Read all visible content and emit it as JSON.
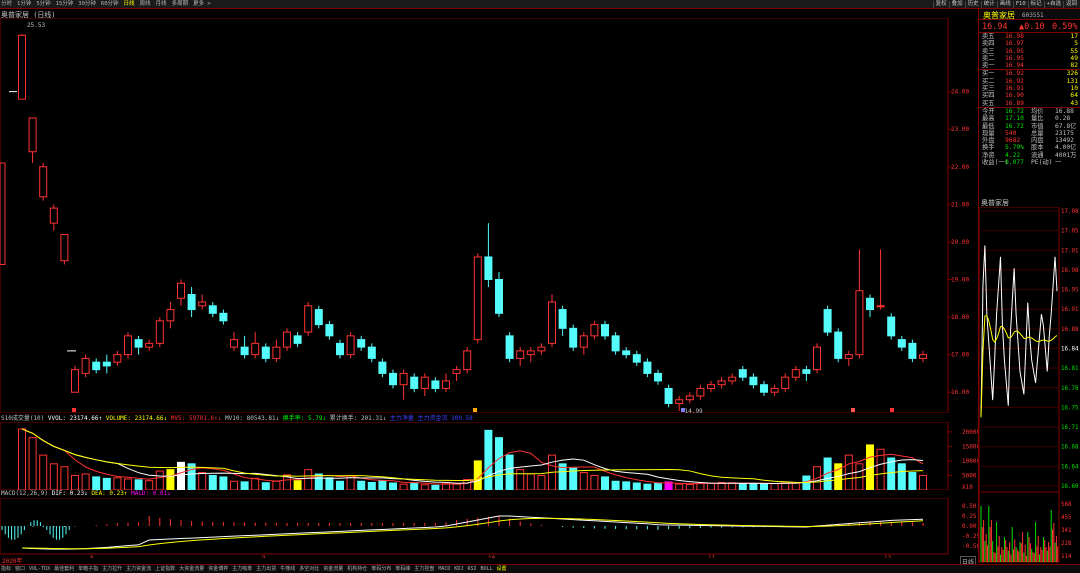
{
  "toolbar": {
    "tabs": [
      "分时",
      "1分钟",
      "5分钟",
      "15分钟",
      "30分钟",
      "60分钟",
      "日线",
      "周线",
      "月线",
      "多周期",
      "更多 >"
    ],
    "active_tab": "日线",
    "right_buttons": [
      "复权",
      "叠加",
      "历史",
      "统计",
      "画线",
      "F10",
      "标记",
      "+自选",
      "返回"
    ]
  },
  "chart": {
    "title": "奥普家居 (日线)",
    "year_label": "2020年",
    "period_label": "日线",
    "high_label": "25.53",
    "low_label": "14.99",
    "price_ticks": [
      "24.00",
      "23.00",
      "22.00",
      "21.00",
      "20.00",
      "19.00",
      "18.00",
      "17.00",
      "16.00"
    ],
    "x_ticks": [
      "8",
      "9",
      "10",
      "11",
      "12"
    ],
    "indicator_vol": {
      "name": "S10成交量(10)",
      "vvol": "VVOL: 23174.66↑",
      "volume": "VOLUME: 23174.66↓",
      "mv5": "MV5: 59701.6↑↓",
      "mv10": "MV10: 80543.81↓",
      "turnover": "换手率: 5.79↓",
      "acc_turnover": "累计换手: 201.31↓",
      "extra1": "主力净量",
      "extra2": "主力资金流 100.58",
      "ticks": [
        "20000",
        "15000",
        "10000",
        "5000",
        "X10"
      ]
    },
    "indicator_macd": {
      "name": "MACD(12,26,9)",
      "dif": "DIF: 0.23↓",
      "dea": "DEA: 0.23↑",
      "macd": "MACD: 0.01↓",
      "ticks": [
        "0.50",
        "0.25",
        "0.00",
        "-0.25",
        "-0.50"
      ]
    }
  },
  "quote": {
    "name": "奥普家居",
    "code": "603551",
    "price": "16.94",
    "change": "▲0.10",
    "change_pct": "0.59%",
    "asks": [
      {
        "label": "卖五",
        "price": "16.98",
        "vol": "17"
      },
      {
        "label": "卖四",
        "price": "16.97",
        "vol": "5"
      },
      {
        "label": "卖三",
        "price": "16.95",
        "vol": "55"
      },
      {
        "label": "卖二",
        "price": "16.95",
        "vol": "49"
      },
      {
        "label": "卖一",
        "price": "16.94",
        "vol": "82"
      }
    ],
    "bids": [
      {
        "label": "买一",
        "price": "16.92",
        "vol": "326"
      },
      {
        "label": "买二",
        "price": "16.92",
        "vol": "131"
      },
      {
        "label": "买三",
        "price": "16.91",
        "vol": "10"
      },
      {
        "label": "买四",
        "price": "16.90",
        "vol": "64"
      },
      {
        "label": "买五",
        "price": "16.89",
        "vol": "43"
      }
    ],
    "stats": [
      {
        "l1": "今开",
        "v1": "16.72",
        "l2": "均价",
        "v2": "16.88"
      },
      {
        "l1": "最高",
        "v1": "17.10",
        "l2": "量比",
        "v2": "0.28"
      },
      {
        "l1": "最低",
        "v1": "16.72",
        "l2": "市值",
        "v2": "67.8亿"
      },
      {
        "l1": "现量",
        "v1": "540",
        "l2": "总量",
        "v2": "23175"
      },
      {
        "l1": "外盘",
        "v1": "9682",
        "l2": "内盘",
        "v2": "13492"
      },
      {
        "l1": "换手",
        "v1": "5.79%",
        "l2": "股本",
        "v2": "4.00亿"
      },
      {
        "l1": "净资",
        "v1": "4.22",
        "l2": "流通",
        "v2": "4001万"
      },
      {
        "l1": "收益(一)",
        "v1": "0.077",
        "l2": "PE(动)",
        "v2": "一"
      }
    ]
  },
  "intraday": {
    "title": "奥普家居",
    "price_ticks": [
      "17.08",
      "17.05",
      "17.01",
      "16.98",
      "16.95",
      "16.91",
      "16.88",
      "16.84",
      "16.81",
      "16.78",
      "16.75",
      "16.71",
      "16.68",
      "16.64",
      "16.60"
    ],
    "vol_ticks": [
      "568",
      "455",
      "341",
      "228",
      "114"
    ]
  },
  "bottom": {
    "items": [
      "指标",
      "窗口",
      "VOL-TDX",
      "最佳套利",
      "单箱子指",
      "主力拉升",
      "主力资金流",
      "上证指数",
      "大资金流量",
      "资金博弈",
      "主力吸筹",
      "主力出货",
      "牛熊线",
      "多空对比",
      "资金流量",
      "机构持仓",
      "筹码分布",
      "筹码峰",
      "主力控盘",
      "MACD",
      "KDJ",
      "RSI",
      "BOLL",
      "设置"
    ],
    "active": "设置"
  },
  "colors": {
    "up": "#ff3333",
    "down": "#54fcfc",
    "bg": "#000000",
    "grid": "#800000",
    "ma1": "#ffffff",
    "ma2": "#ff0000",
    "ma3": "#ffff00"
  }
}
